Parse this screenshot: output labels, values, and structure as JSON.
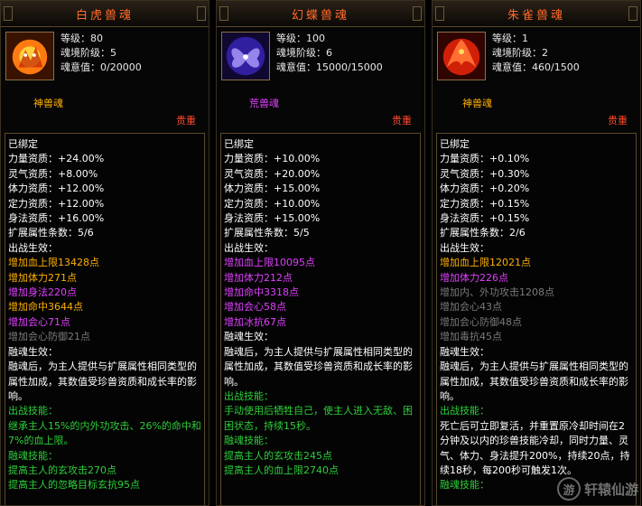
{
  "panels": [
    {
      "title": "白虎兽魂",
      "stats": [
        "等级：80",
        "魂境阶级：5",
        "魂意值：0/20000"
      ],
      "soul_type": "神兽魂",
      "rarity": "贵重",
      "icon": "white-tiger-icon",
      "lines": [
        "已绑定",
        "力量资质：+24.00%",
        "灵气资质：+8.00%",
        "体力资质：+12.00%",
        "定力资质：+12.00%",
        "身法资质：+16.00%",
        "扩展属性条数：5/6",
        "出战生效：",
        "增加血上限13428点",
        "增加体力271点",
        "增加身法220点",
        "增加命中3644点",
        "增加会心71点",
        "增加会心防御21点",
        "融魂生效：",
        "融魂后，为主人提供与扩展属性相同类型的属性加成，其数值受珍兽资质和成长率的影响。",
        "出战技能：",
        "继承主人15%的内外功攻击、26%的命中和7%的血上限。",
        "融魂技能：",
        "提高主人的玄攻击270点",
        "提高主人的忽略目标玄抗95点"
      ]
    },
    {
      "title": "幻蝶兽魂",
      "stats": [
        "等级：100",
        "魂境阶级：6",
        "魂意值：15000/15000"
      ],
      "soul_type": "荒兽魂",
      "rarity": "贵重",
      "icon": "phantom-butterfly-icon",
      "lines": [
        "已绑定",
        "力量资质：+10.00%",
        "灵气资质：+20.00%",
        "体力资质：+15.00%",
        "定力资质：+10.00%",
        "身法资质：+15.00%",
        "扩展属性条数：5/5",
        "出战生效：",
        "增加血上限10095点",
        "增加体力212点",
        "增加命中3318点",
        "增加会心58点",
        "增加冰抗67点",
        "融魂生效：",
        "融魂后，为主人提供与扩展属性相同类型的属性加成，其数值受珍兽资质和成长率的影响。",
        "出战技能：",
        "手动使用后牺牲自己，使主人进入无敌、困困状态，持续15秒。",
        "融魂技能：",
        "提高主人的玄攻击245点",
        "提高主人的血上限2740点"
      ]
    },
    {
      "title": "朱雀兽魂",
      "stats": [
        "等级：1",
        "魂境阶级：2",
        "魂意值：460/1500"
      ],
      "soul_type": "神兽魂",
      "rarity": "贵重",
      "icon": "vermilion-bird-icon",
      "lines": [
        "已绑定",
        "力量资质：+0.10%",
        "灵气资质：+0.30%",
        "体力资质：+0.20%",
        "定力资质：+0.15%",
        "身法资质：+0.15%",
        "扩展属性条数：2/6",
        "出战生效：",
        "增加血上限12021点",
        "增加体力226点",
        "增加内、外功攻击1208点",
        "增加会心43点",
        "增加会心防御48点",
        "增加毒抗45点",
        "融魂生效：",
        "融魂后，为主人提供与扩展属性相同类型的属性加成，其数值受珍兽资质和成长率的影响。",
        "出战技能：",
        "死亡后可立即复活，并重置原冷却时间在2分钟及以内的珍兽技能冷却，同时力量、灵气、体力、身法提升200%，持续20点，持续18秒，每200秒可触发1次。",
        "融魂技能："
      ]
    }
  ],
  "watermark": {
    "logo": "游",
    "text": "轩辕仙游"
  },
  "colors": {
    "title": "#ff6a2a",
    "orange": "#ffb000",
    "magenta": "#e040ff",
    "gray": "#7a7a7a",
    "green": "#2ecf3a",
    "rare": "#ff4a2a"
  }
}
